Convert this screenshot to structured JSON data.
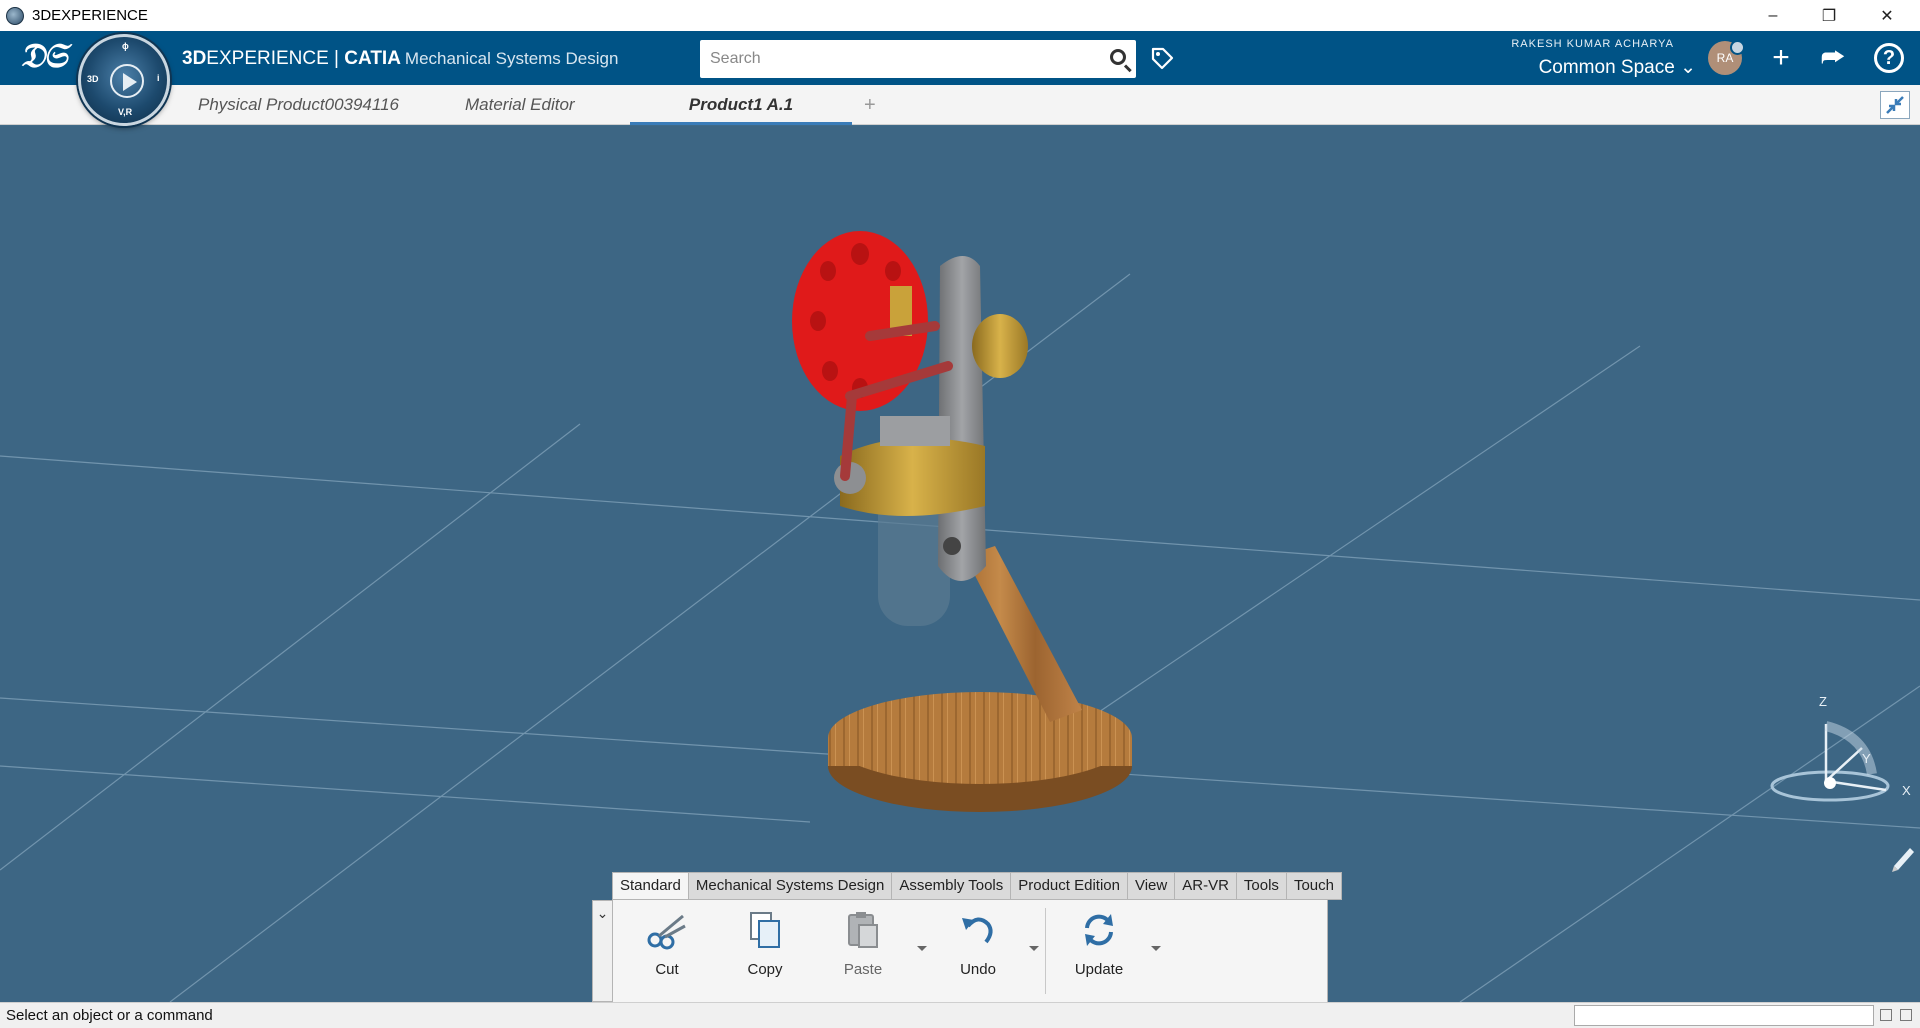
{
  "window": {
    "title": "3DEXPERIENCE",
    "controls": {
      "minimize": "–",
      "restore": "❐",
      "close": "✕"
    }
  },
  "header": {
    "brand_prefix": "3D",
    "brand_main": "EXPERIENCE | ",
    "brand_catia": "CATIA",
    "app_name": "Mechanical Systems Design",
    "compass": {
      "top": "ϕ",
      "left": "3D",
      "right": "i",
      "bottom": "V,R"
    },
    "search_placeholder": "Search",
    "user_name": "RAKESH KUMAR ACHARYA",
    "space": "Common Space ⌄",
    "avatar_initials": "RA",
    "plus_icon": "+",
    "share_icon": "⮫",
    "help_icon": "?"
  },
  "tabs": [
    {
      "label": "Physical Product00394116"
    },
    {
      "label": "Material Editor"
    },
    {
      "label": "Product1 A.1"
    }
  ],
  "tab_add": "+",
  "toolbar": {
    "tabs": [
      "Standard",
      "Mechanical Systems Design",
      "Assembly Tools",
      "Product Edition",
      "View",
      "AR-VR",
      "Tools",
      "Touch"
    ],
    "chevron": "⌄",
    "tools": {
      "cut": "Cut",
      "copy": "Copy",
      "paste": "Paste",
      "undo": "Undo",
      "update": "Update"
    }
  },
  "compass_axes": {
    "x": "X",
    "y": "Y",
    "z": "Z"
  },
  "status": {
    "message": "Select an object or a command"
  },
  "colors": {
    "accent": "#005386",
    "viewport_bg": "#3d6684",
    "wheel": "#e01a1a",
    "gold": "#c9a23a",
    "wood": "#b07a3c"
  }
}
